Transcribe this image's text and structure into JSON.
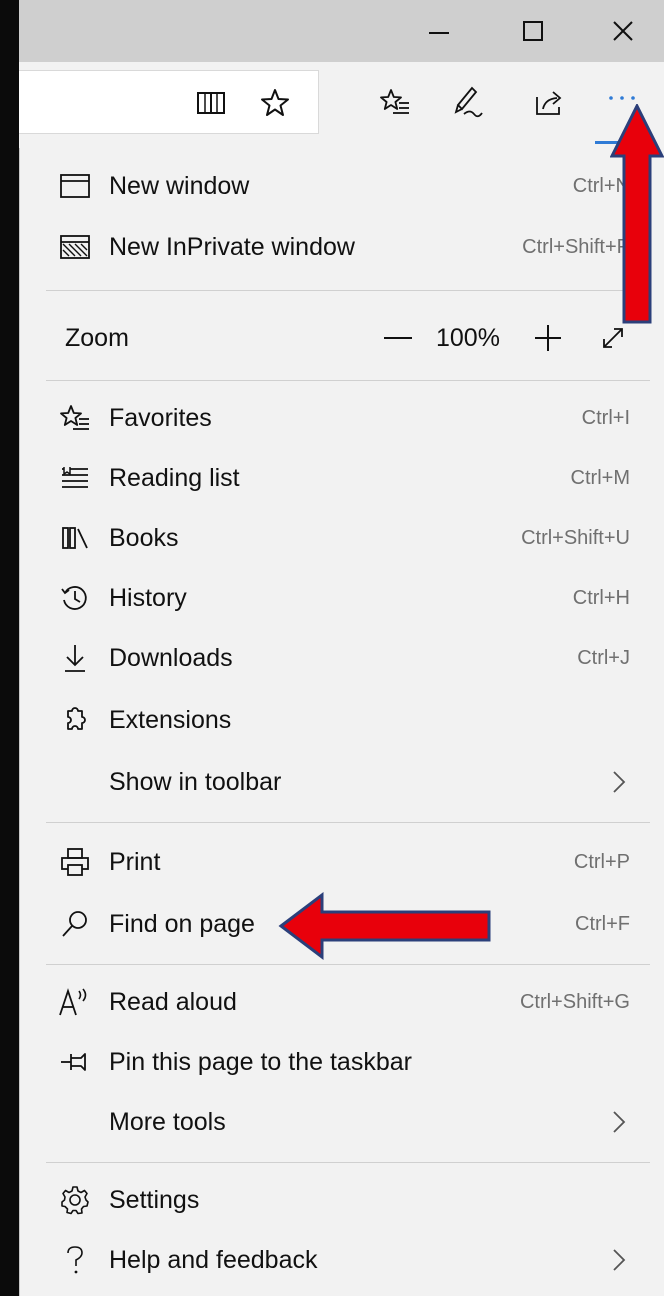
{
  "title_bar": {
    "minimize_icon": "minimize-icon",
    "maximize_icon": "maximize-icon",
    "close_icon": "close-icon"
  },
  "toolbar": {
    "icons": [
      "reading-view-icon",
      "add-favorite-icon",
      "favorites-icon",
      "add-notes-icon",
      "share-icon",
      "settings-and-more-icon"
    ],
    "more_label": "···"
  },
  "menu": {
    "group1": [
      {
        "label": "New window",
        "shortcut": "Ctrl+N"
      },
      {
        "label": "New InPrivate window",
        "shortcut": "Ctrl+Shift+P"
      }
    ],
    "zoom": {
      "label": "Zoom",
      "value": "100%"
    },
    "group2": [
      {
        "label": "Favorites",
        "shortcut": "Ctrl+I"
      },
      {
        "label": "Reading list",
        "shortcut": "Ctrl+M"
      },
      {
        "label": "Books",
        "shortcut": "Ctrl+Shift+U"
      },
      {
        "label": "History",
        "shortcut": "Ctrl+H"
      },
      {
        "label": "Downloads",
        "shortcut": "Ctrl+J"
      },
      {
        "label": "Extensions",
        "shortcut": ""
      },
      {
        "label": "Show in toolbar",
        "shortcut": ""
      }
    ],
    "group3": [
      {
        "label": "Print",
        "shortcut": "Ctrl+P"
      },
      {
        "label": "Find on page",
        "shortcut": "Ctrl+F"
      }
    ],
    "group4": [
      {
        "label": "Read aloud",
        "shortcut": "Ctrl+Shift+G"
      },
      {
        "label": "Pin this page to the taskbar",
        "shortcut": ""
      },
      {
        "label": "More tools",
        "shortcut": ""
      }
    ],
    "group5": [
      {
        "label": "Settings",
        "shortcut": ""
      },
      {
        "label": "Help and feedback",
        "shortcut": ""
      }
    ]
  },
  "annotation_color": "#e8000b",
  "annotation_outline": "#2b3f7a",
  "accent_color": "#2f7bd6"
}
